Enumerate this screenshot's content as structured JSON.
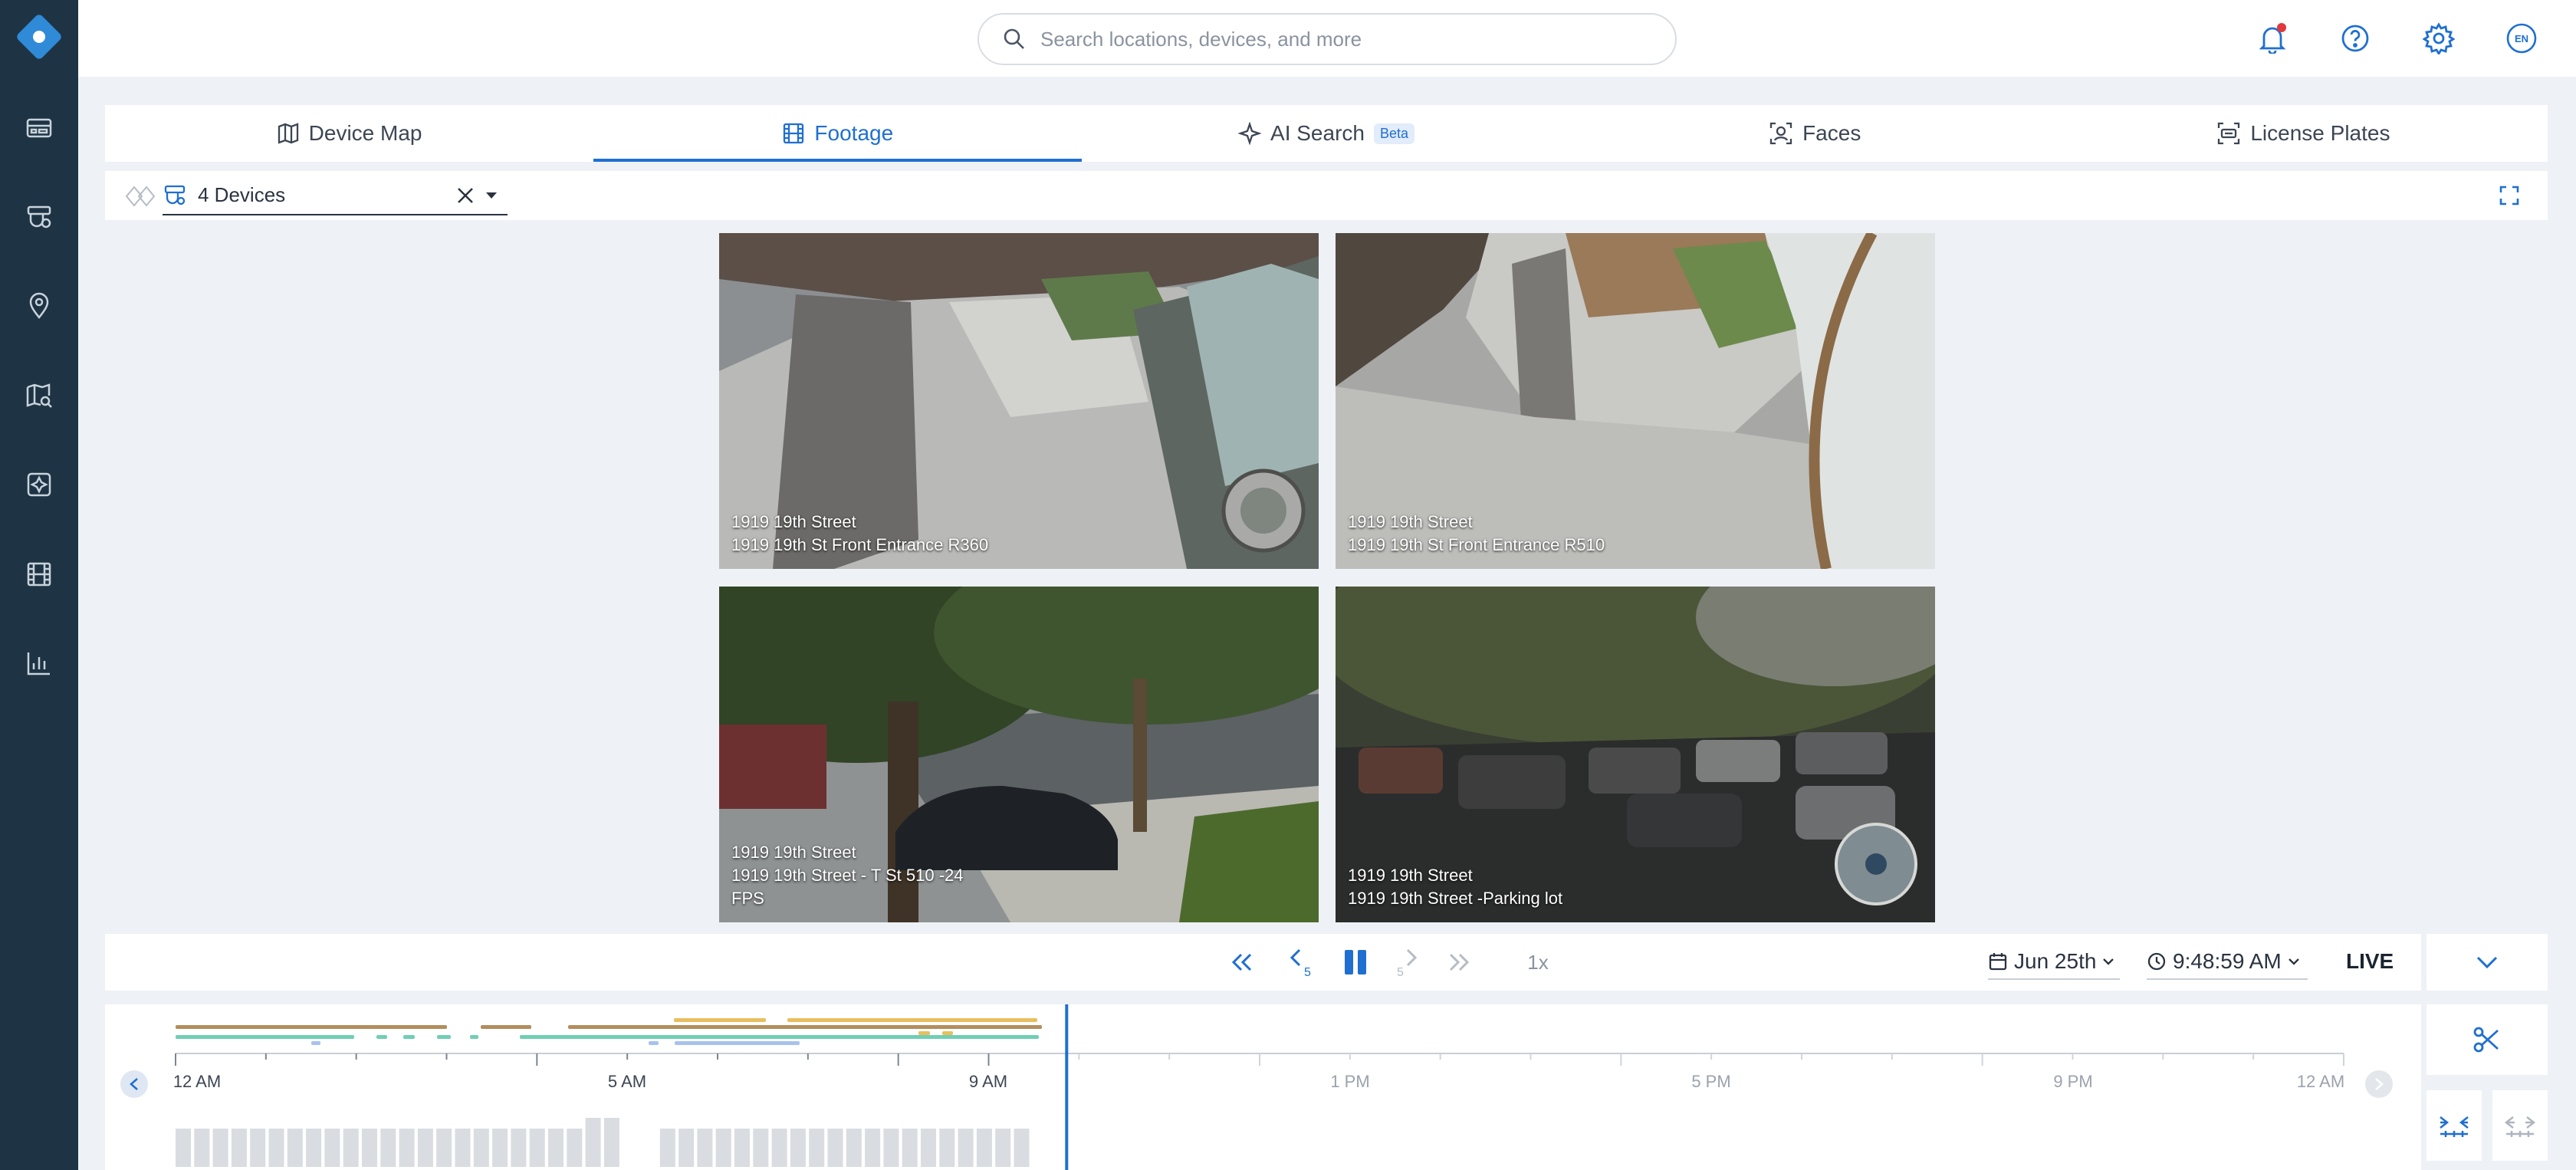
{
  "header": {
    "search_placeholder": "Search locations, devices, and more",
    "language": "EN"
  },
  "sidebar": {
    "items": [
      {
        "name": "dashboard-icon"
      },
      {
        "name": "cameras-icon"
      },
      {
        "name": "locations-icon"
      },
      {
        "name": "map-search-icon"
      },
      {
        "name": "integrations-icon"
      },
      {
        "name": "footage-icon"
      },
      {
        "name": "analytics-icon"
      }
    ]
  },
  "tabs": [
    {
      "label": "Device Map",
      "icon": "map-icon",
      "active": false
    },
    {
      "label": "Footage",
      "icon": "film-icon",
      "active": true
    },
    {
      "label": "AI Search",
      "icon": "sparkle-icon",
      "active": false,
      "badge": "Beta"
    },
    {
      "label": "Faces",
      "icon": "face-scan-icon",
      "active": false
    },
    {
      "label": "License Plates",
      "icon": "license-plate-icon",
      "active": false
    }
  ],
  "device_filter": {
    "value": "4 Devices"
  },
  "cameras": [
    {
      "location": "1919 19th Street",
      "name": "1919 19th St Front Entrance R360",
      "extra": ""
    },
    {
      "location": "1919 19th Street",
      "name": "1919 19th St Front Entrance R510",
      "extra": ""
    },
    {
      "location": "1919 19th Street",
      "name": "1919 19th Street - T St 510 -24",
      "extra": "FPS"
    },
    {
      "location": "1919 19th Street",
      "name": "1919 19th Street -Parking lot",
      "extra": ""
    }
  ],
  "playback": {
    "speed": "1x",
    "date": "Jun 25th",
    "time": "9:48:59 AM",
    "live_label": "LIVE"
  },
  "timeline": {
    "labels": [
      "12 AM",
      "5 AM",
      "9 AM",
      "1 PM",
      "5 PM",
      "9 PM",
      "12 AM"
    ],
    "current_position": 0.411
  },
  "colors": {
    "accent": "#1f6fd1",
    "sidebar": "#1e3444",
    "track_brown": "#b48d5e",
    "track_gold": "#e8bf5f",
    "track_teal": "#6fcfb4",
    "track_lightblue": "#a8c2ec"
  }
}
